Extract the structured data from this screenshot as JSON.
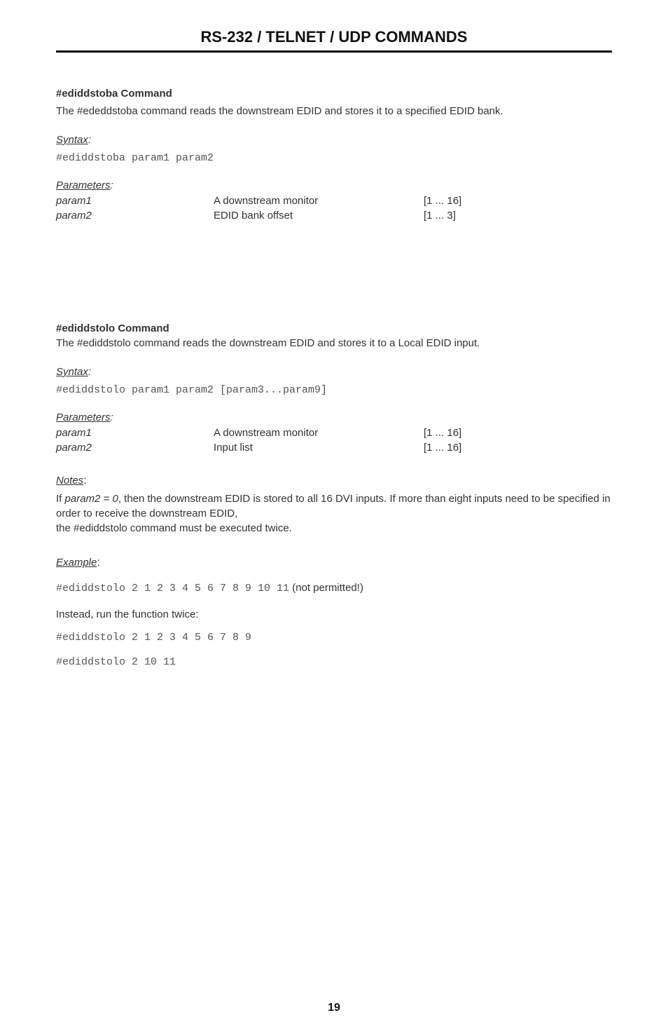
{
  "header": {
    "title": "RS-232 / TELNET / UDP COMMANDS"
  },
  "cmd1": {
    "title": "#ediddstoba Command",
    "desc": "The #ededdstoba command reads the downstream EDID and stores it to a specified EDID bank.",
    "syntax_label": "Syntax",
    "syntax_code": "#ediddstoba param1 param2",
    "params_label": "Parameters",
    "params": [
      {
        "name": "param1",
        "desc": "A downstream monitor",
        "range": "[1 ... 16]"
      },
      {
        "name": "param2",
        "desc": "EDID bank offset",
        "range": "[1 ... 3]"
      }
    ]
  },
  "cmd2": {
    "title": "#ediddstolo Command",
    "desc": "The #ediddstolo command reads the downstream EDID and stores it to a Local EDID input.",
    "syntax_label": "Syntax",
    "syntax_code": "#ediddstolo param1 param2 [param3...param9]",
    "params_label": "Parameters",
    "params": [
      {
        "name": "param1",
        "desc": "A downstream monitor",
        "range": "[1 ... 16]"
      },
      {
        "name": "param2",
        "desc": "Input list",
        "range": "[1 ... 16]"
      }
    ],
    "notes_label": "Notes",
    "notes_prefix": "If ",
    "notes_emph": "param2 = 0",
    "notes_rest": ", then the downstream EDID is stored to all 16 DVI inputs.  If more than eight inputs need to be specified in order to receive the downstream EDID,",
    "notes_line2": "the #ediddstolo command must be executed twice.",
    "example_label": "Example",
    "example_code1": "#ediddstolo 2 1 2 3 4 5 6 7 8 9 10 11",
    "example_code1_note": " (not permitted!)",
    "example_instead": "Instead, run the function twice:",
    "example_code2": "#ediddstolo 2 1 2 3 4 5 6 7 8 9",
    "example_code3": "#ediddstolo 2 10 11"
  },
  "page_number": "19"
}
